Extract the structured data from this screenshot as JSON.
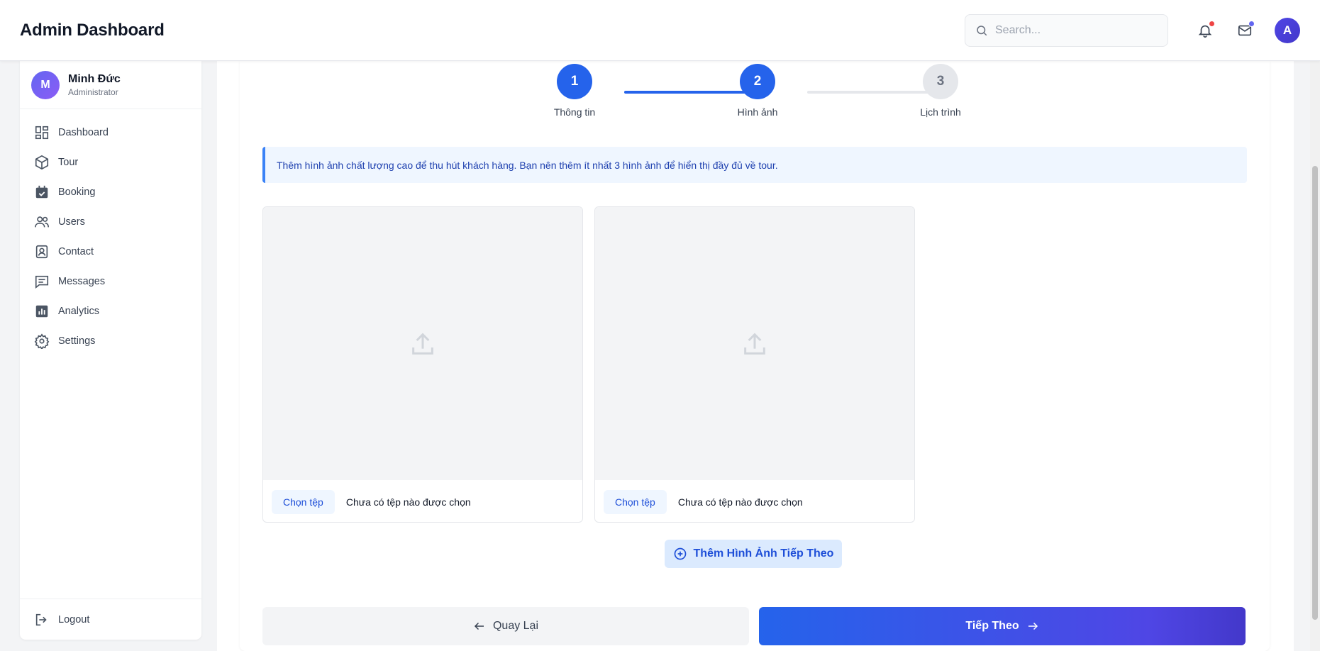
{
  "header": {
    "title": "Admin Dashboard",
    "search_placeholder": "Search...",
    "avatar_initial": "A",
    "notification_dot_color": "#ef4444",
    "mail_dot_color": "#6366f1"
  },
  "sidebar": {
    "profile": {
      "initial": "M",
      "name": "Minh Đức",
      "role": "Administrator"
    },
    "items": [
      {
        "label": "Dashboard",
        "icon": "dashboard-icon"
      },
      {
        "label": "Tour",
        "icon": "box-icon"
      },
      {
        "label": "Booking",
        "icon": "calendar-check-icon"
      },
      {
        "label": "Users",
        "icon": "users-icon"
      },
      {
        "label": "Contact",
        "icon": "contact-icon"
      },
      {
        "label": "Messages",
        "icon": "messages-icon"
      },
      {
        "label": "Analytics",
        "icon": "analytics-icon"
      },
      {
        "label": "Settings",
        "icon": "gear-icon"
      }
    ],
    "logout_label": "Logout"
  },
  "stepper": {
    "steps": [
      {
        "number": "1",
        "label": "Thông tin",
        "state": "done"
      },
      {
        "number": "2",
        "label": "Hình ảnh",
        "state": "active"
      },
      {
        "number": "3",
        "label": "Lịch trình",
        "state": "todo"
      }
    ]
  },
  "info_text": "Thêm hình ảnh chất lượng cao để thu hút khách hàng. Bạn nên thêm ít nhất 3 hình ảnh để hiển thị đầy đủ về tour.",
  "uploads": [
    {
      "button_label": "Chọn tệp",
      "status_text": "Chưa có tệp nào được chọn"
    },
    {
      "button_label": "Chọn tệp",
      "status_text": "Chưa có tệp nào được chọn"
    }
  ],
  "actions": {
    "add_image_label": "Thêm Hình Ảnh Tiếp Theo",
    "back_label": "Quay Lại",
    "next_label": "Tiếp Theo"
  },
  "colors": {
    "primary": "#2563eb",
    "accent": "#4f46e5",
    "info_bg": "#eff6ff"
  }
}
